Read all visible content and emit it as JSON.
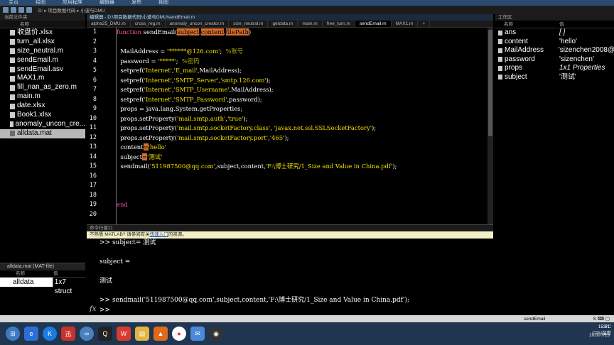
{
  "menubar": [
    "主页",
    "绘图",
    "应用程序",
    "编辑器",
    "发布",
    "视图"
  ],
  "toolbar_path": "D: ▸ 项目数据代码 ▸ 小波与DMU",
  "current_folder": {
    "title": "当前文件夹",
    "col_name": "名称",
    "files": [
      "收盘价.xlsx",
      "turn_all.xlsx",
      "size_neutral.m",
      "sendEmail.m",
      "sendEmail.asv",
      "MAX1.m",
      "fill_nan_as_zero.m",
      "main.m",
      "date.xlsx",
      "Book1.xlsx",
      "anomaly_uncon_cre...",
      "alldata.mat"
    ],
    "selected_index": 11
  },
  "details": {
    "title": "alldata.mat (MAT-file)",
    "col_name": "名称",
    "col_value": "值",
    "row_name": "alldata",
    "row_value": "1x7 struct"
  },
  "editor": {
    "title": "编辑器 - D:\\项目数据代码\\小波与DMU\\sendEmail.m",
    "tabs": [
      "alpha25_DMU.m",
      "cross_reg.m",
      "anomaly_uncon_creator.m",
      "size_neutral.m",
      "getdata.m",
      "main.m",
      "free_turn.m",
      "sendEmail.m",
      "MAX1.m",
      "+"
    ],
    "active_tab": 7,
    "line_numbers": [
      "1",
      "2",
      "3",
      "4",
      "5",
      "6",
      "7",
      "8",
      "9",
      "10",
      "11",
      "12",
      "13",
      "14",
      "15",
      "16",
      "17",
      "18",
      "19",
      "20"
    ]
  },
  "command_window": {
    "title": "命令行窗口",
    "notice": "不熟悉 MATLAB? 请参阅有关",
    "notice_link": "快速入门",
    "notice_tail": "的资源。",
    "lines": [
      ">> subject= 测试",
      "",
      "subject =",
      "",
      "测试",
      "",
      ">> sendmail('511987500@qq.com',subject,content,'F:\\博士研究/1_Size and Value in China.pdf');",
      ">>"
    ],
    "fx": "fx"
  },
  "workspace": {
    "title": "工作区",
    "col_name": "名称",
    "col_value": "值",
    "vars": [
      {
        "name": "ans",
        "value": "[ ]",
        "italic": true
      },
      {
        "name": "content",
        "value": "'hello'",
        "italic": false
      },
      {
        "name": "MailAddress",
        "value": "'sizenchen2008@",
        "italic": false
      },
      {
        "name": "password",
        "value": "'sizenchen'",
        "italic": false
      },
      {
        "name": "props",
        "value": "1x1 Properties",
        "italic": true
      },
      {
        "name": "subject",
        "value": "'测试'",
        "italic": false
      }
    ]
  },
  "status": {
    "function": "sendEmail",
    "cpu_label": "CPU温度",
    "cpu_temp": "53°C",
    "time": "15:51",
    "date": "2020/7/23"
  },
  "taskbar_icons": [
    "start-icon",
    "ie-icon",
    "kugou-icon",
    "xunlei-icon",
    "network-icon",
    "qq-icon",
    "wps-icon",
    "folder-icon",
    "matlab-icon",
    "chrome-icon",
    "mail-icon",
    "obs-icon"
  ],
  "accent": "#d36d2b"
}
